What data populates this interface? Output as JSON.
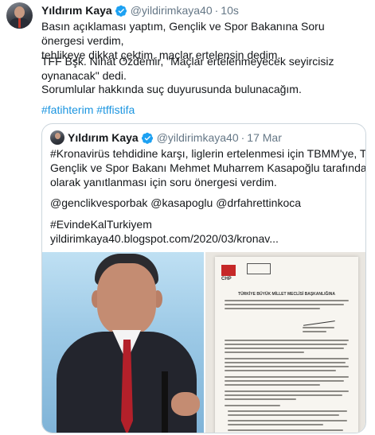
{
  "tweet": {
    "author_name": "Yıldırım Kaya",
    "author_handle": "@yildirimkaya40",
    "separator": "·",
    "time": "10s",
    "paragraph1_line1": "Basın açıklaması yaptım, Gençlik ve Spor Bakanına Soru önergesi verdim,",
    "paragraph1_line2": "tehlikeye dikkat çektim, maçlar ertelensin dedim.",
    "paragraph2": "TFF Bşk. Nihat Özdemir, \"Maçlar ertelenmeyecek seyircisiz oynanacak\" dedi.",
    "paragraph3": "Sorumlular hakkında suç duyurusunda bulunacağım.",
    "hashtags": [
      "#fatihterim",
      "#tffistifa"
    ]
  },
  "quoted_tweet": {
    "author_name": "Yıldırım Kaya",
    "author_handle": "@yildirimkaya40",
    "separator": "·",
    "date": "17 Mar",
    "line1": "#Kronavirüs tehdidine karşı, liglerin ertelenmesi için TBMM'ye, T.C.",
    "line2": "Gençlik ve Spor Bakanı Mehmet Muharrem Kasapoğlu tarafından yazılı",
    "line3": "olarak yanıtlanması için soru önergesi verdim.",
    "mentions": "@genclikvesporbak @kasapoglu @drfahrettinkoca",
    "hashtag": "#EvindeKalTurkiyem",
    "link": "yildirimkaya40.blogspot.com/2020/03/kronav...",
    "doc_logo_text": "CHP",
    "doc_header": "TÜRKİYE BÜYÜK MİLLET MECLİSİ BAŞKANLIĞINA"
  },
  "colors": {
    "link_blue": "#1b95e0",
    "verified_blue": "#1da1f2",
    "muted_gray": "#657786"
  },
  "icons": [
    "verified-badge-icon"
  ]
}
